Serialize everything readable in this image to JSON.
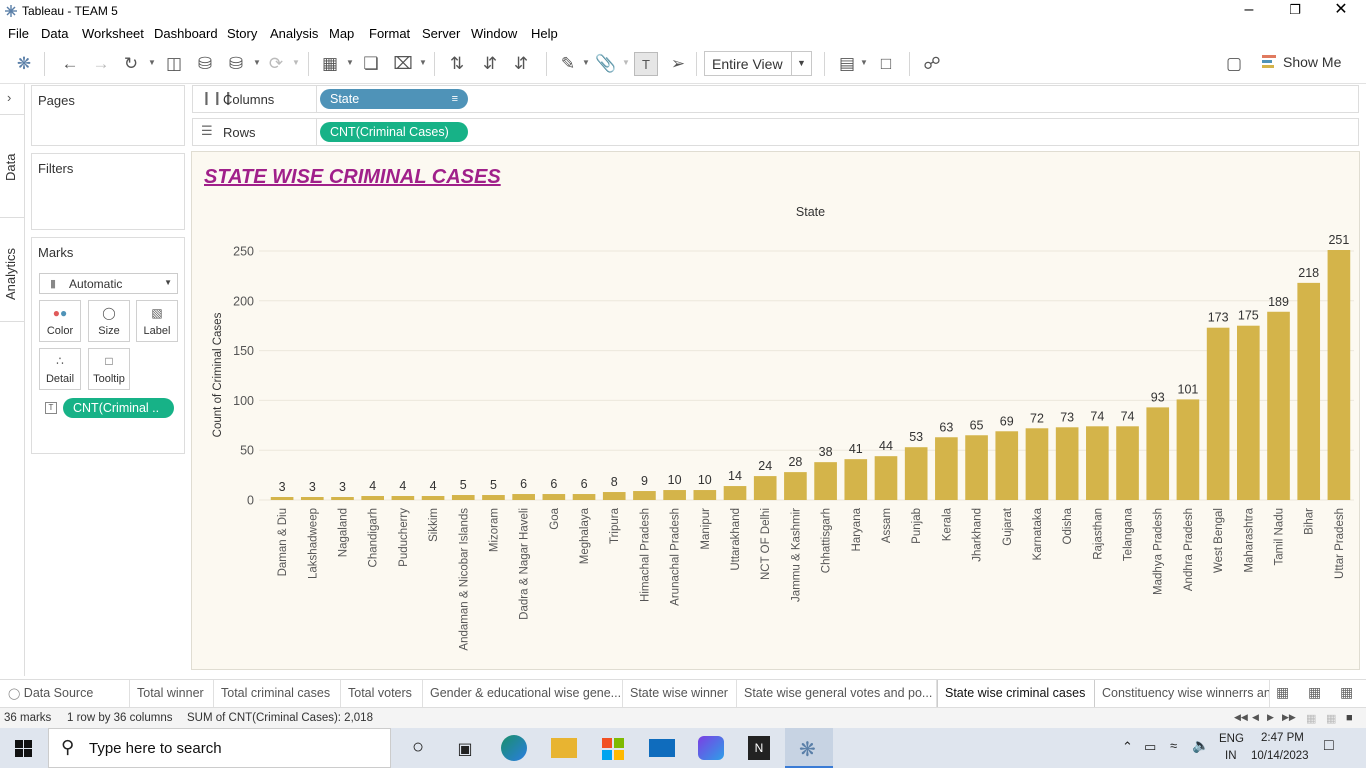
{
  "window": {
    "title": "Tableau - TEAM 5"
  },
  "menu": [
    "File",
    "Data",
    "Worksheet",
    "Dashboard",
    "Story",
    "Analysis",
    "Map",
    "Format",
    "Server",
    "Window",
    "Help"
  ],
  "toolbar": {
    "view_select": "Entire View",
    "show_me": "Show Me"
  },
  "side_tabs": {
    "data": "Data",
    "analytics": "Analytics"
  },
  "cards": {
    "pages": "Pages",
    "filters": "Filters",
    "marks": "Marks"
  },
  "marks": {
    "type": "Automatic",
    "buttons": {
      "color": "Color",
      "size": "Size",
      "label": "Label",
      "detail": "Detail",
      "tooltip": "Tooltip"
    },
    "field": "CNT(Criminal .."
  },
  "shelves": {
    "columns_label": "Columns",
    "columns_pill": "State",
    "rows_label": "Rows",
    "rows_pill": "CNT(Criminal  Cases)"
  },
  "chart_title": "STATE WISE CRIMINAL CASES",
  "chart_data": {
    "type": "bar",
    "title": "STATE WISE CRIMINAL CASES",
    "xlabel": "State",
    "ylabel": "Count of Criminal Cases",
    "ylim": [
      0,
      260
    ],
    "yticks": [
      0,
      50,
      100,
      150,
      200,
      250
    ],
    "bar_color": "#d4b44a",
    "categories": [
      "Daman & Diu",
      "Lakshadweep",
      "Nagaland",
      "Chandigarh",
      "Puducherry",
      "Sikkim",
      "Andaman & Nicobar Islands",
      "Mizoram",
      "Dadra & Nagar Haveli",
      "Goa",
      "Meghalaya",
      "Tripura",
      "Himachal Pradesh",
      "Arunachal Pradesh",
      "Manipur",
      "Uttarakhand",
      "NCT OF Delhi",
      "Jammu & Kashmir",
      "Chhattisgarh",
      "Haryana",
      "Assam",
      "Punjab",
      "Kerala",
      "Jharkhand",
      "Gujarat",
      "Karnataka",
      "Odisha",
      "Rajasthan",
      "Telangana",
      "Madhya Pradesh",
      "Andhra Pradesh",
      "West Bengal",
      "Maharashtra",
      "Tamil Nadu",
      "Bihar",
      "Uttar Pradesh"
    ],
    "values": [
      3,
      3,
      3,
      4,
      4,
      4,
      5,
      5,
      6,
      6,
      6,
      8,
      9,
      10,
      10,
      14,
      24,
      28,
      38,
      41,
      44,
      53,
      63,
      65,
      69,
      72,
      73,
      74,
      74,
      93,
      101,
      173,
      175,
      189,
      218,
      251
    ]
  },
  "tabs": [
    "Data Source",
    "Total winner",
    "Total criminal cases",
    "Total voters",
    "Gender & educational wise gene...",
    "State wise winner",
    "State wise general votes and po...",
    "State wise criminal cases",
    "Constituency wise winnerrs an"
  ],
  "active_tab": "State wise criminal cases",
  "status": {
    "marks": "36 marks",
    "shape": "1 row by 36 columns",
    "sum": "SUM of CNT(Criminal  Cases): 2,018"
  },
  "taskbar": {
    "search_placeholder": "Type here to search",
    "lang1": "ENG",
    "lang2": "IN",
    "time": "2:47 PM",
    "date": "10/14/2023"
  },
  "colors": {
    "pill_blue": "#4f93b8",
    "pill_green": "#17b287",
    "title_purple": "#a0208a",
    "viz_bg": "#fcf9f1"
  }
}
